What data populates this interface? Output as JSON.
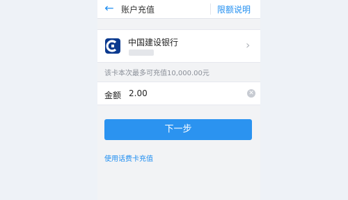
{
  "header": {
    "title": "账户充值",
    "limit_link": "限额说明",
    "back_icon": "arrow-left-icon"
  },
  "bank_card": {
    "name": "中国建设银行",
    "logo_icon": "ccb-logo-icon",
    "chevron_icon": "chevron-right-icon"
  },
  "limit_note": "该卡本次最多可充值10,000.00元",
  "amount": {
    "label": "金额",
    "value": "2.00",
    "clear_icon": "clear-icon"
  },
  "next_button": "下一步",
  "phone_card_topup_link": "使用话费卡充值",
  "colors": {
    "accent": "#2b93f0",
    "link": "#1f8ef1",
    "background": "#f2f3f5"
  }
}
